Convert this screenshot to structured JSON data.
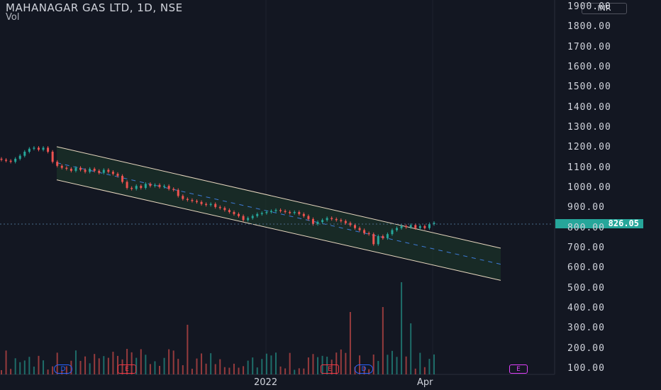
{
  "header": {
    "title": "MAHANAGAR GAS LTD, 1D, NSE",
    "vol_label": "Vol",
    "currency": "INR"
  },
  "price_tag": "826.05",
  "y_axis_labels": [
    "1900.00",
    "1800.00",
    "1700.00",
    "1600.00",
    "1500.00",
    "1400.00",
    "1300.00",
    "1200.00",
    "1100.00",
    "1000.00",
    "900.00",
    "800.00",
    "700.00",
    "600.00",
    "500.00",
    "400.00",
    "300.00",
    "200.00",
    "100.00"
  ],
  "x_axis_labels": [
    "2022",
    "Apr"
  ],
  "events": [
    {
      "label": "D",
      "color": "#2962ff"
    },
    {
      "label": "E",
      "color": "#f23645"
    },
    {
      "label": "E",
      "color": "#f23645"
    },
    {
      "label": "D",
      "color": "#2962ff"
    },
    {
      "label": "E",
      "color": "#e040fb"
    }
  ],
  "colors": {
    "up": "#26a69a",
    "down": "#ef5350",
    "channel": "#e8d8c0",
    "midline": "#3d7bd9",
    "fill": "#1e3a2a"
  },
  "chart_data": {
    "type": "candlestick",
    "title": "MAHANAGAR GAS LTD, 1D, NSE",
    "price_scale": {
      "min": 100,
      "max": 1900
    },
    "last_price": 826.05,
    "channel": {
      "upper": [
        {
          "date": "2021-10",
          "price": 1205
        },
        {
          "date": "2022-05",
          "price": 700
        }
      ],
      "lower": [
        {
          "date": "2021-10",
          "price": 1040
        },
        {
          "date": "2022-05",
          "price": 540
        }
      ],
      "middle": [
        {
          "date": "2021-10",
          "price": 1125
        },
        {
          "date": "2022-05",
          "price": 620
        }
      ]
    },
    "close_series": [
      1140,
      1135,
      1130,
      1145,
      1160,
      1180,
      1195,
      1200,
      1190,
      1200,
      1180,
      1130,
      1110,
      1100,
      1095,
      1085,
      1100,
      1090,
      1080,
      1095,
      1085,
      1075,
      1090,
      1080,
      1070,
      1060,
      1030,
      1000,
      995,
      1010,
      1000,
      1020,
      1010,
      1015,
      1005,
      1010,
      995,
      990,
      960,
      945,
      940,
      935,
      930,
      920,
      915,
      920,
      905,
      900,
      890,
      880,
      870,
      860,
      840,
      850,
      860,
      870,
      875,
      880,
      885,
      890,
      885,
      880,
      875,
      880,
      870,
      860,
      845,
      820,
      830,
      840,
      850,
      845,
      840,
      835,
      825,
      815,
      800,
      790,
      775,
      770,
      720,
      760,
      750,
      770,
      790,
      800,
      810,
      805,
      815,
      800,
      810,
      800,
      820,
      826
    ]
  }
}
